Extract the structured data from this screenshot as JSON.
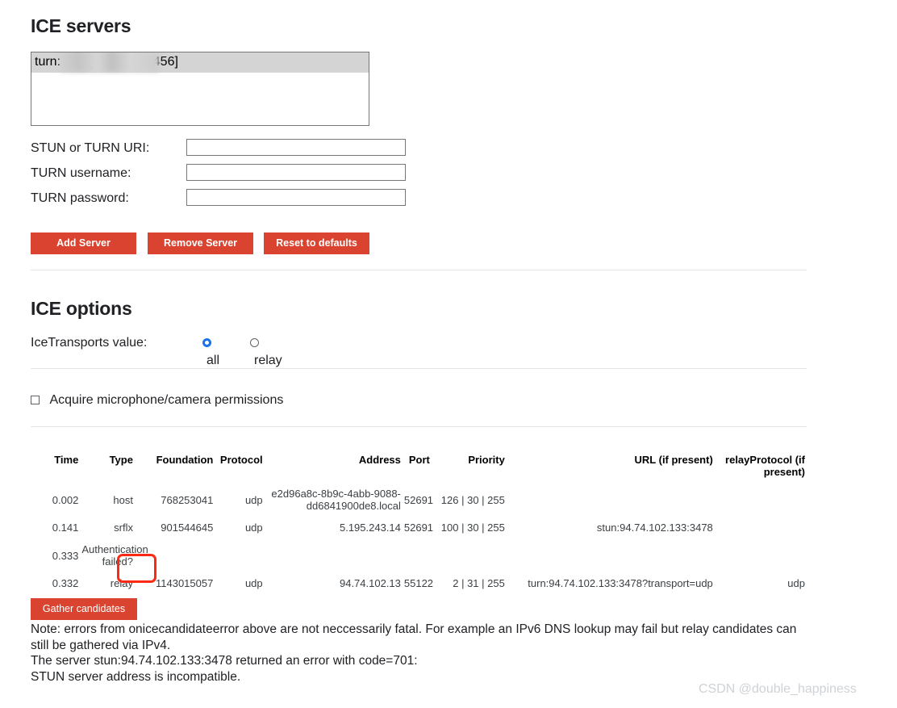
{
  "ice_servers": {
    "title": "ICE servers",
    "server_list": [
      {
        "label": "turn:                 478 [admin:123456]",
        "selected": true
      }
    ],
    "fields": {
      "uri_label": "STUN or TURN URI:",
      "uri_value": "",
      "uri_placeholder": "",
      "username_label": "TURN username:",
      "username_value": "",
      "username_placeholder": "",
      "password_label": "TURN password:",
      "password_value": "",
      "password_placeholder": ""
    },
    "buttons": {
      "add": "Add Server",
      "remove": "Remove Server",
      "reset": "Reset to defaults"
    }
  },
  "ice_options": {
    "title": "ICE options",
    "transports_label": "IceTransports value:",
    "transports_options": [
      {
        "label": "all",
        "checked": true
      },
      {
        "label": "relay",
        "checked": false
      }
    ],
    "permissions_label": "Acquire microphone/camera permissions",
    "permissions_checked": false
  },
  "candidates_table": {
    "headers": [
      "Time",
      "Type",
      "Foundation",
      "Protocol",
      "Address",
      "Port",
      "Priority",
      "URL (if present)",
      "relayProtocol (if present)"
    ],
    "rows": [
      {
        "time": "0.002",
        "type": "host",
        "foundation": "768253041",
        "protocol": "udp",
        "address": "e2d96a8c-8b9c-4abb-9088-dd6841900de8.local",
        "port": "52691",
        "priority": "126 | 30 | 255",
        "url": "",
        "relay_protocol": ""
      },
      {
        "time": "0.141",
        "type": "srflx",
        "foundation": "901544645",
        "protocol": "udp",
        "address": "5.195.243.14",
        "port": "52691",
        "priority": "100 | 30 | 255",
        "url": "stun:94.74.102.133:3478",
        "relay_protocol": ""
      },
      {
        "time": "0.333",
        "type": "Authentication failed?",
        "foundation": "",
        "protocol": "",
        "address": "",
        "port": "",
        "priority": "",
        "url": "",
        "relay_protocol": ""
      },
      {
        "time": "0.332",
        "type": "relay",
        "foundation": "1143015057",
        "protocol": "udp",
        "address": "94.74.102.13",
        "port": "55122",
        "priority": "2 | 31 | 255",
        "url": "turn:94.74.102.133:3478?transport=udp",
        "relay_protocol": "udp"
      }
    ]
  },
  "footer": {
    "gather_button": "Gather candidates",
    "notes": [
      "Note: errors from onicecandidateerror above are not neccessarily fatal. For example an IPv6 DNS lookup may fail but relay candidates can still be gathered via IPv4.",
      "The server stun:94.74.102.133:3478 returned an error with code=701:",
      "STUN server address is incompatible."
    ]
  },
  "watermark": "CSDN @double_happiness",
  "colors": {
    "button_red": "#d9432f",
    "radio_blue": "#1a73e8",
    "annotation_red": "#fc2a15",
    "selection_gray": "#d4d4d4"
  }
}
